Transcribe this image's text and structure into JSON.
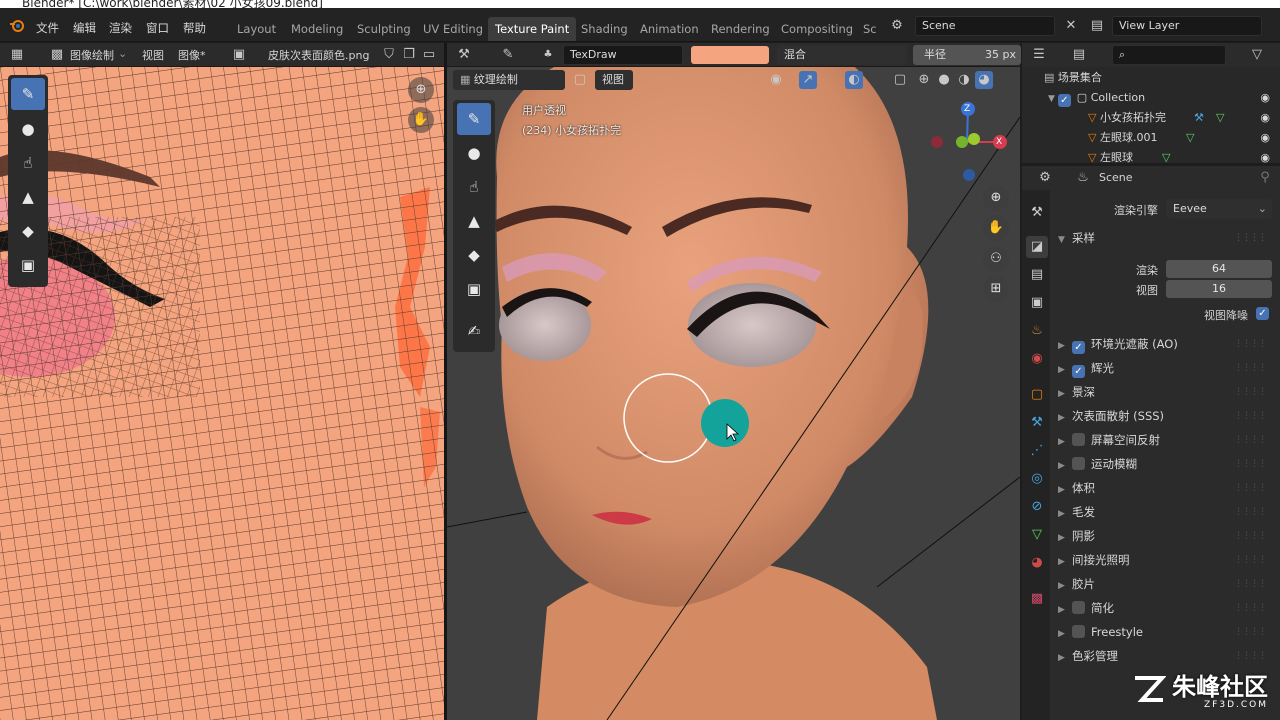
{
  "window": {
    "title": "Blender* [C:\\work\\blender\\素材\\02 小女孩09.blend]"
  },
  "menu": {
    "items": [
      "文件",
      "编辑",
      "渲染",
      "窗口",
      "帮助"
    ]
  },
  "workspaces": {
    "tabs": [
      "Layout",
      "Modeling",
      "Sculpting",
      "UV Editing",
      "Texture Paint",
      "Shading",
      "Animation",
      "Rendering",
      "Compositing",
      "Sc"
    ],
    "active": "Texture Paint"
  },
  "scene": {
    "name": "Scene",
    "view_layer": "View Layer"
  },
  "image_editor": {
    "mode": "图像绘制",
    "menu_view": "视图",
    "menu_image": "图像*",
    "image_name": "皮肤次表面颜色.png",
    "tools": [
      "brush-icon",
      "drop-icon",
      "smear-icon",
      "stamp-icon",
      "fill-icon",
      "mask-icon"
    ],
    "active_tool": 0
  },
  "tool_header": {
    "brush": "TexDraw",
    "color": "#f4a47e",
    "blend": "混合",
    "radius_label": "半径",
    "radius_value": "35 px"
  },
  "viewport": {
    "mode": "纹理绘制",
    "menu_view": "视图",
    "overlay_line1": "用户透视",
    "overlay_line2": "(234) 小女孩拓扑完",
    "tools": [
      "brush-icon",
      "drop-icon",
      "smear-icon",
      "stamp-icon",
      "fill-icon",
      "mask-icon",
      "annotate-icon"
    ],
    "active_tool": 0,
    "gizmo": {
      "z": "Z",
      "x": "X"
    }
  },
  "outliner": {
    "root": "场景集合",
    "collection": "Collection",
    "items": [
      "小女孩拓扑完",
      "左眼球.001",
      "左眼球"
    ]
  },
  "properties": {
    "context": "Scene",
    "render_engine_label": "渲染引擎",
    "render_engine": "Eevee",
    "sampling": {
      "label": "采样",
      "render_label": "渲染",
      "render_value": "64",
      "viewport_label": "视图",
      "viewport_value": "16",
      "denoise_label": "视图降噪",
      "denoise": true
    },
    "panels": [
      {
        "label": "环境光遮蔽 (AO)",
        "checkbox": true,
        "checked": true
      },
      {
        "label": "辉光",
        "checkbox": true,
        "checked": true
      },
      {
        "label": "景深",
        "checkbox": false
      },
      {
        "label": "次表面散射 (SSS)",
        "checkbox": false
      },
      {
        "label": "屏幕空间反射",
        "checkbox": true,
        "checked": false
      },
      {
        "label": "运动模糊",
        "checkbox": true,
        "checked": false
      },
      {
        "label": "体积",
        "checkbox": false
      },
      {
        "label": "毛发",
        "checkbox": false
      },
      {
        "label": "阴影",
        "checkbox": false
      },
      {
        "label": "间接光照明",
        "checkbox": false
      },
      {
        "label": "胶片",
        "checkbox": false
      },
      {
        "label": "简化",
        "checkbox": true,
        "checked": false
      },
      {
        "label": "Freestyle",
        "checkbox": true,
        "checked": false
      },
      {
        "label": "色彩管理",
        "checkbox": false
      }
    ]
  },
  "watermark": {
    "brand": "朱峰社区",
    "url": "ZF3D.COM"
  },
  "colors": {
    "accent": "#4772b3",
    "skin": "#f4a47e",
    "cursor": "#13a39a"
  }
}
